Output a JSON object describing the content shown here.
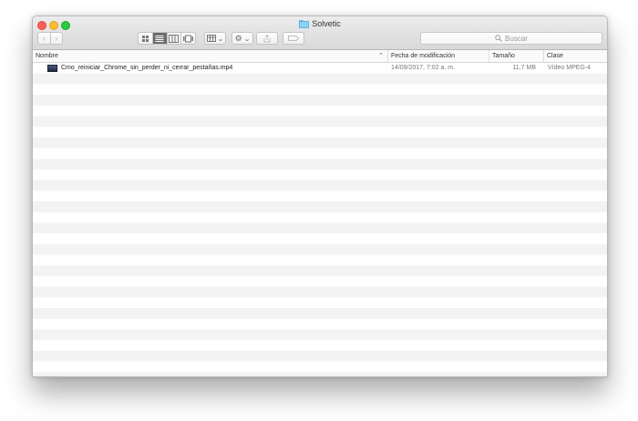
{
  "window": {
    "title": "Solvetic"
  },
  "toolbar": {
    "back_label": "‹",
    "forward_label": "›",
    "arrange_caret": "⌄",
    "action_caret": "⌄"
  },
  "search": {
    "placeholder": "Buscar",
    "icon": "magnifier-icon"
  },
  "columns": [
    {
      "label": "Nombre",
      "sorted": "ascending"
    },
    {
      "label": "Fecha de modificación"
    },
    {
      "label": "Tamaño"
    },
    {
      "label": "Clase"
    }
  ],
  "files": [
    {
      "name": "Cmo_reiniciar_Chrome_sin_perder_ni_cerrar_pestañas.mp4",
      "modified": "14/09/2017, 7:02 a. m.",
      "size": "11,7 MB",
      "kind": "Vídeo MPEG-4",
      "icon": "video-file-icon"
    }
  ],
  "colors": {
    "close": "#fc5f57",
    "minimize": "#fdbc2e",
    "maximize": "#29c940",
    "folder": "#8ed0f6",
    "active_view": "#6c6c6c"
  }
}
